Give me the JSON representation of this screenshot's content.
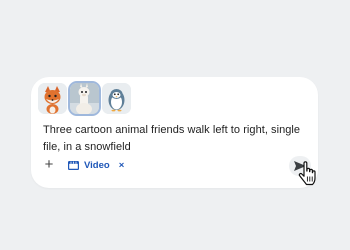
{
  "references": {
    "items": [
      {
        "name": "fox",
        "selected": false
      },
      {
        "name": "llama",
        "selected": true
      },
      {
        "name": "penguin",
        "selected": false
      }
    ]
  },
  "prompt": {
    "text": "Three cartoon animal friends walk left to right, single file, in a snowfield"
  },
  "toolbar": {
    "add_label": "+",
    "mode_chip": {
      "label": "Video",
      "icon": "film-icon"
    },
    "remove_label": "×"
  },
  "colors": {
    "background": "#eef0f2",
    "card": "#ffffff",
    "accent": "#1f57b8",
    "text": "#1f1f1f"
  }
}
